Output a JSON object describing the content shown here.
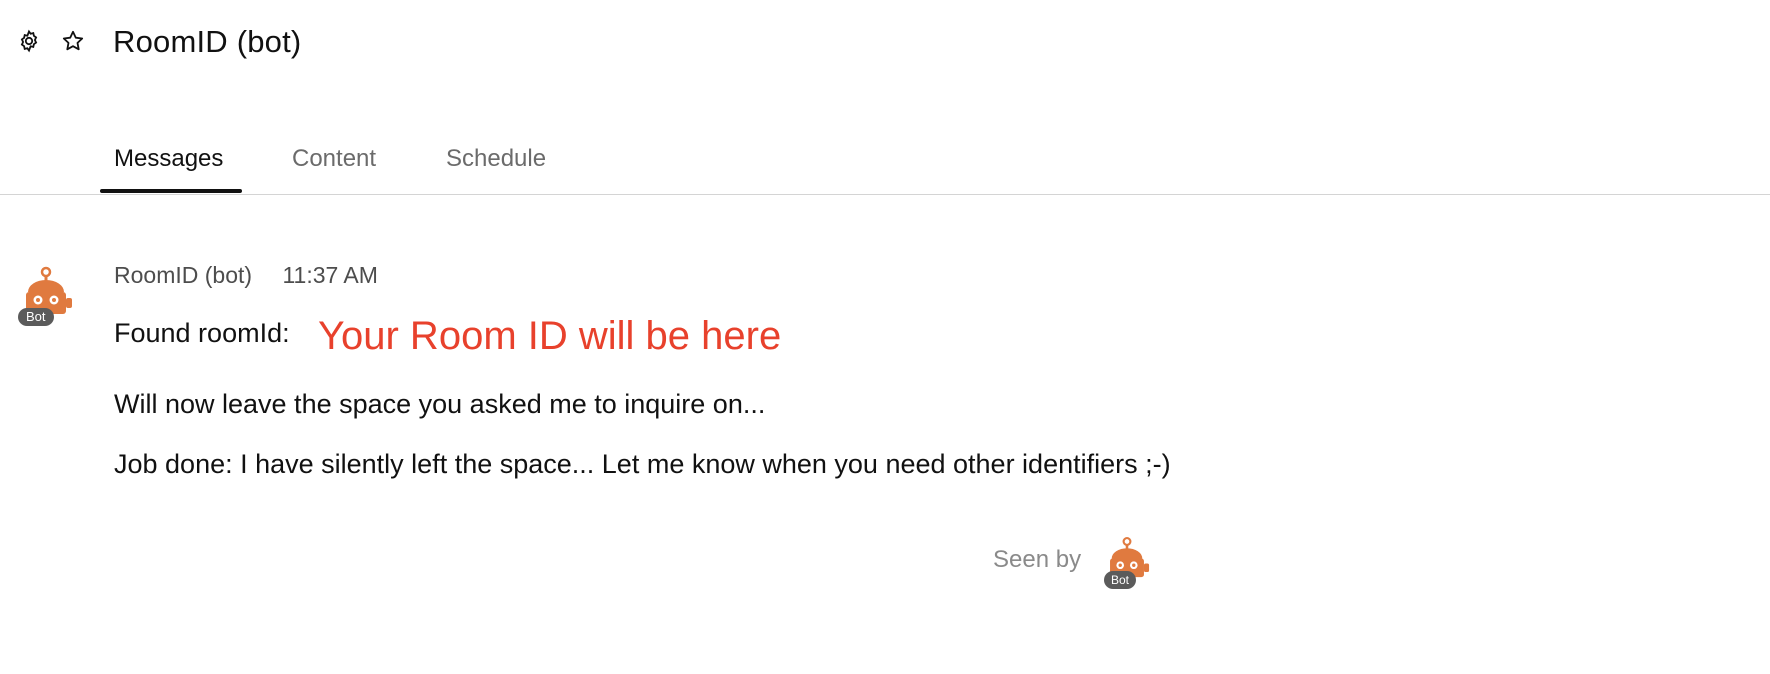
{
  "header": {
    "title": "RoomID (bot)",
    "settings_icon": "gear-icon",
    "favorite_icon": "star-icon"
  },
  "tabs": [
    {
      "label": "Messages",
      "active": true
    },
    {
      "label": "Content",
      "active": false
    },
    {
      "label": "Schedule",
      "active": false
    }
  ],
  "message": {
    "sender": "RoomID (bot)",
    "time": "11:37 AM",
    "avatar_badge": "Bot",
    "found_label": "Found roomId:",
    "room_id_placeholder": "Your Room ID will be here",
    "line1": "Will now leave the space you asked me to inquire on...",
    "line2": "Job done: I have silently left the space... Let me know when you need other identifiers ;-)"
  },
  "seen": {
    "label": "Seen by",
    "avatar_badge": "Bot"
  },
  "colors": {
    "accent_red": "#e8412c",
    "bot_orange": "#e07a3f"
  }
}
